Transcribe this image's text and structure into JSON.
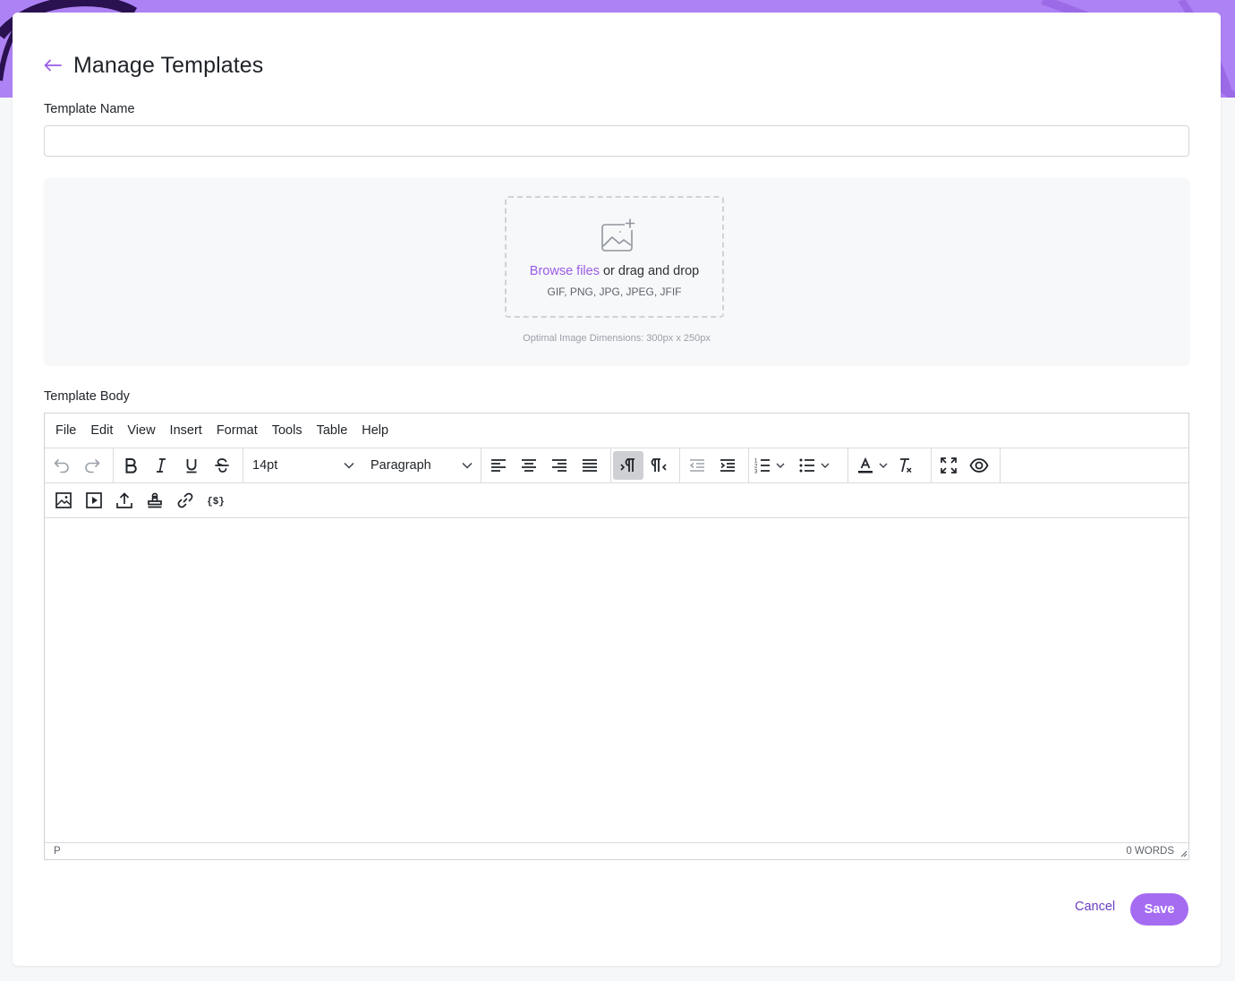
{
  "theme": {
    "accent": "#a56cf2",
    "band": "#ad82f4",
    "link": "#9a5ce6"
  },
  "header": {
    "title": "Manage Templates",
    "back_icon": "arrow-left-icon"
  },
  "form": {
    "name_label": "Template Name",
    "name_value": "",
    "body_label": "Template Body"
  },
  "upload": {
    "browse": "Browse files",
    "or_text": " or drag and drop",
    "types": "GIF, PNG, JPG, JPEG, JFIF",
    "hint": "Optimal Image Dimensions: 300px x 250px",
    "icon": "image-add-icon"
  },
  "editor": {
    "menus": [
      "File",
      "Edit",
      "View",
      "Insert",
      "Format",
      "Tools",
      "Table",
      "Help"
    ],
    "font_size": "14pt",
    "block_format": "Paragraph",
    "status_path": "P",
    "word_count": "0 WORDS"
  },
  "actions": {
    "cancel": "Cancel",
    "save": "Save"
  }
}
